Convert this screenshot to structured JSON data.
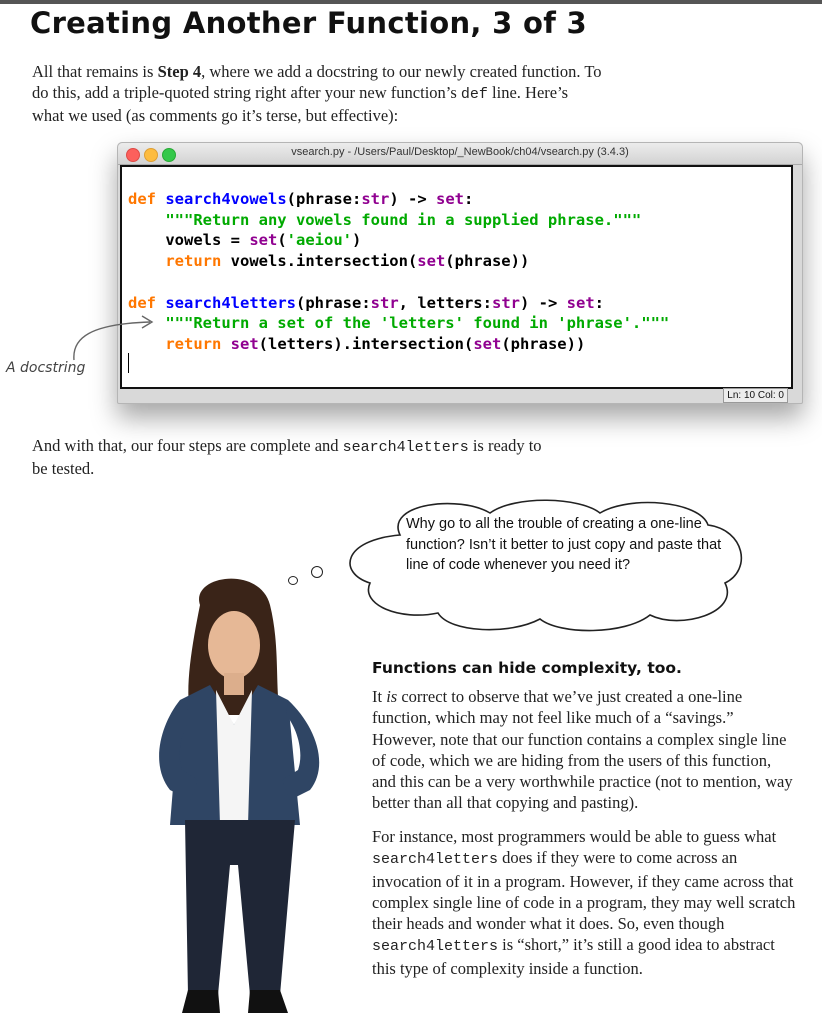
{
  "page": {
    "title": "Creating Another Function, 3 of 3",
    "intro": {
      "t1": "All that remains is ",
      "step": "Step 4",
      "t2": ", where we add a docstring to our newly created function. To do this, add a triple-quoted string right after your new function’s ",
      "code": "def",
      "t3": " line. Here’s what we used (as comments go it’s terse, but effective):"
    },
    "after": {
      "t1": "And with that, our four steps are complete and ",
      "code": "search4letters",
      "t2": " is ready to be tested."
    }
  },
  "editor": {
    "window_title": "vsearch.py - /Users/Paul/Desktop/_NewBook/ch04/vsearch.py (3.4.3)",
    "status": "Ln: 10  Col: 0",
    "tokens": {
      "def": "def",
      "return": "return",
      "set": "set",
      "fn1": "search4vowels",
      "sig1": "(phrase:",
      "str": "str",
      "arrow": ") -> ",
      "doc1": "\"\"\"Return any vowels found in a supplied phrase.\"\"\"",
      "vowels_assign": "vowels = ",
      "aeiou": "'aeiou'",
      "close": ")",
      "ret1a": " vowels.intersection(",
      "ret1b": "(phrase))",
      "fn2": "search4letters",
      "sig2a": "(phrase:",
      "sig2b": ", letters:",
      "doc2": "\"\"\"Return a set of the 'letters' found in 'phrase'.\"\"\"",
      "ret2a": "(letters).intersection(",
      "ret2b": "(phrase))",
      "colon": ":",
      "open": "("
    }
  },
  "annotation": "A docstring",
  "thought": "Why go to all the trouble of creating a one-line function? Isn’t it better to just copy and paste that line of code whenever you need it?",
  "answer": {
    "heading": "Functions can hide complexity, too.",
    "p1a": "It ",
    "p1_is": "is",
    "p1b": " correct to observe that we’ve just created a one-line function, which may not feel like much of a “savings.” However, note that our function contains a complex single line of code, which we are hiding from the users of this function, and this can be a very worthwhile practice (not to mention, way better than all that copying and pasting).",
    "p2a": "For instance, most programmers would be able to guess what ",
    "p2_code": "search4letters",
    "p2b": " does if they were to come across an invocation of it in a program. However, if they came across that complex single line of code in a program, they may well scratch their heads and wonder what it does. So, even though ",
    "p2_code2": "search4letters",
    "p2c": " is “short,” it’s still a good idea to abstract this type of complexity inside a function."
  },
  "colors": {
    "keyword": "#ff7700",
    "function": "#0000ff",
    "builtin": "#900090",
    "string": "#00aa00"
  }
}
